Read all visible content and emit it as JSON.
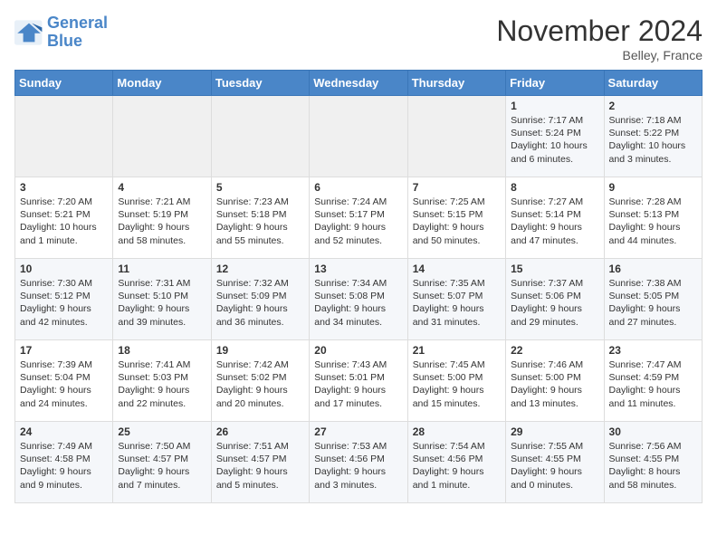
{
  "logo": {
    "line1": "General",
    "line2": "Blue"
  },
  "title": "November 2024",
  "location": "Belley, France",
  "headers": [
    "Sunday",
    "Monday",
    "Tuesday",
    "Wednesday",
    "Thursday",
    "Friday",
    "Saturday"
  ],
  "weeks": [
    [
      {
        "day": "",
        "info": ""
      },
      {
        "day": "",
        "info": ""
      },
      {
        "day": "",
        "info": ""
      },
      {
        "day": "",
        "info": ""
      },
      {
        "day": "",
        "info": ""
      },
      {
        "day": "1",
        "info": "Sunrise: 7:17 AM\nSunset: 5:24 PM\nDaylight: 10 hours and 6 minutes."
      },
      {
        "day": "2",
        "info": "Sunrise: 7:18 AM\nSunset: 5:22 PM\nDaylight: 10 hours and 3 minutes."
      }
    ],
    [
      {
        "day": "3",
        "info": "Sunrise: 7:20 AM\nSunset: 5:21 PM\nDaylight: 10 hours and 1 minute."
      },
      {
        "day": "4",
        "info": "Sunrise: 7:21 AM\nSunset: 5:19 PM\nDaylight: 9 hours and 58 minutes."
      },
      {
        "day": "5",
        "info": "Sunrise: 7:23 AM\nSunset: 5:18 PM\nDaylight: 9 hours and 55 minutes."
      },
      {
        "day": "6",
        "info": "Sunrise: 7:24 AM\nSunset: 5:17 PM\nDaylight: 9 hours and 52 minutes."
      },
      {
        "day": "7",
        "info": "Sunrise: 7:25 AM\nSunset: 5:15 PM\nDaylight: 9 hours and 50 minutes."
      },
      {
        "day": "8",
        "info": "Sunrise: 7:27 AM\nSunset: 5:14 PM\nDaylight: 9 hours and 47 minutes."
      },
      {
        "day": "9",
        "info": "Sunrise: 7:28 AM\nSunset: 5:13 PM\nDaylight: 9 hours and 44 minutes."
      }
    ],
    [
      {
        "day": "10",
        "info": "Sunrise: 7:30 AM\nSunset: 5:12 PM\nDaylight: 9 hours and 42 minutes."
      },
      {
        "day": "11",
        "info": "Sunrise: 7:31 AM\nSunset: 5:10 PM\nDaylight: 9 hours and 39 minutes."
      },
      {
        "day": "12",
        "info": "Sunrise: 7:32 AM\nSunset: 5:09 PM\nDaylight: 9 hours and 36 minutes."
      },
      {
        "day": "13",
        "info": "Sunrise: 7:34 AM\nSunset: 5:08 PM\nDaylight: 9 hours and 34 minutes."
      },
      {
        "day": "14",
        "info": "Sunrise: 7:35 AM\nSunset: 5:07 PM\nDaylight: 9 hours and 31 minutes."
      },
      {
        "day": "15",
        "info": "Sunrise: 7:37 AM\nSunset: 5:06 PM\nDaylight: 9 hours and 29 minutes."
      },
      {
        "day": "16",
        "info": "Sunrise: 7:38 AM\nSunset: 5:05 PM\nDaylight: 9 hours and 27 minutes."
      }
    ],
    [
      {
        "day": "17",
        "info": "Sunrise: 7:39 AM\nSunset: 5:04 PM\nDaylight: 9 hours and 24 minutes."
      },
      {
        "day": "18",
        "info": "Sunrise: 7:41 AM\nSunset: 5:03 PM\nDaylight: 9 hours and 22 minutes."
      },
      {
        "day": "19",
        "info": "Sunrise: 7:42 AM\nSunset: 5:02 PM\nDaylight: 9 hours and 20 minutes."
      },
      {
        "day": "20",
        "info": "Sunrise: 7:43 AM\nSunset: 5:01 PM\nDaylight: 9 hours and 17 minutes."
      },
      {
        "day": "21",
        "info": "Sunrise: 7:45 AM\nSunset: 5:00 PM\nDaylight: 9 hours and 15 minutes."
      },
      {
        "day": "22",
        "info": "Sunrise: 7:46 AM\nSunset: 5:00 PM\nDaylight: 9 hours and 13 minutes."
      },
      {
        "day": "23",
        "info": "Sunrise: 7:47 AM\nSunset: 4:59 PM\nDaylight: 9 hours and 11 minutes."
      }
    ],
    [
      {
        "day": "24",
        "info": "Sunrise: 7:49 AM\nSunset: 4:58 PM\nDaylight: 9 hours and 9 minutes."
      },
      {
        "day": "25",
        "info": "Sunrise: 7:50 AM\nSunset: 4:57 PM\nDaylight: 9 hours and 7 minutes."
      },
      {
        "day": "26",
        "info": "Sunrise: 7:51 AM\nSunset: 4:57 PM\nDaylight: 9 hours and 5 minutes."
      },
      {
        "day": "27",
        "info": "Sunrise: 7:53 AM\nSunset: 4:56 PM\nDaylight: 9 hours and 3 minutes."
      },
      {
        "day": "28",
        "info": "Sunrise: 7:54 AM\nSunset: 4:56 PM\nDaylight: 9 hours and 1 minute."
      },
      {
        "day": "29",
        "info": "Sunrise: 7:55 AM\nSunset: 4:55 PM\nDaylight: 9 hours and 0 minutes."
      },
      {
        "day": "30",
        "info": "Sunrise: 7:56 AM\nSunset: 4:55 PM\nDaylight: 8 hours and 58 minutes."
      }
    ]
  ]
}
